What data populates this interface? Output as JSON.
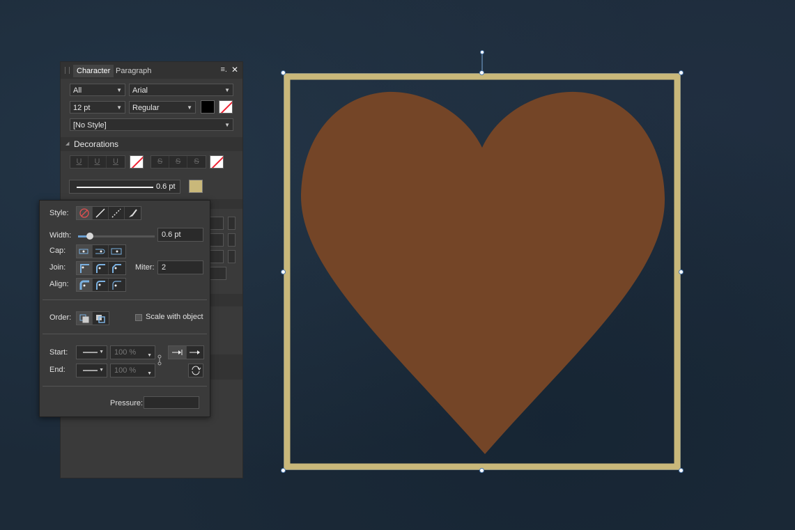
{
  "panel": {
    "tabs": [
      "Character",
      "Paragraph"
    ],
    "menu_icon": "≡.",
    "close_icon": "✕",
    "scope": "All",
    "font": "Arial",
    "size": "12 pt",
    "weight": "Regular",
    "text_color": "#000000",
    "style": "[No Style]",
    "decorations_label": "Decorations",
    "underline_buttons": [
      "U",
      "U",
      "U"
    ],
    "strike_buttons": [
      "S",
      "S",
      "S"
    ],
    "stroke_width": "0.6 pt",
    "stroke_color": "#c9b87a"
  },
  "popup": {
    "style_label": "Style:",
    "width_label": "Width:",
    "width_value": "0.6 pt",
    "width_fraction": 0.06,
    "cap_label": "Cap:",
    "join_label": "Join:",
    "miter_label": "Miter:",
    "miter_value": "2",
    "align_label": "Align:",
    "order_label": "Order:",
    "scale_label": "Scale with object",
    "start_label": "Start:",
    "end_label": "End:",
    "start_percent": "100 %",
    "end_percent": "100 %",
    "pressure_label": "Pressure:"
  },
  "canvas": {
    "heart_color": "#744527",
    "border_color": "#c9b87a",
    "background_color": "#1c2a38"
  }
}
